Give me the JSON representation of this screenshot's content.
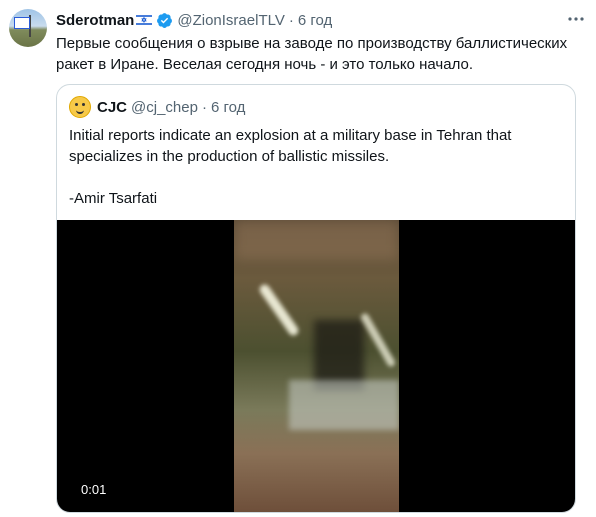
{
  "tweet": {
    "author_name": "Sderotman",
    "handle": "@ZionIsraelTLV",
    "separator": "·",
    "time": "6 год",
    "text": "Первые сообщения о взрыве на заводе по производству баллистических ракет в Иране. Веселая сегодня ночь - и это только начало."
  },
  "quote": {
    "author_name": "CJC",
    "handle": "@cj_chep",
    "separator": "·",
    "time": "6 год",
    "line1": "Initial reports indicate an explosion at a military base in Tehran that specializes in the production of ballistic missiles.",
    "line2": "-Amir Tsarfati"
  },
  "video": {
    "timestamp": "0:01"
  },
  "icons": {
    "verified": "verified-badge-icon",
    "flag": "israel-flag-icon",
    "more": "more-options-icon"
  },
  "colors": {
    "verified_blue": "#1d9bf0",
    "secondary_text": "#536471",
    "border": "#cfd9de"
  }
}
